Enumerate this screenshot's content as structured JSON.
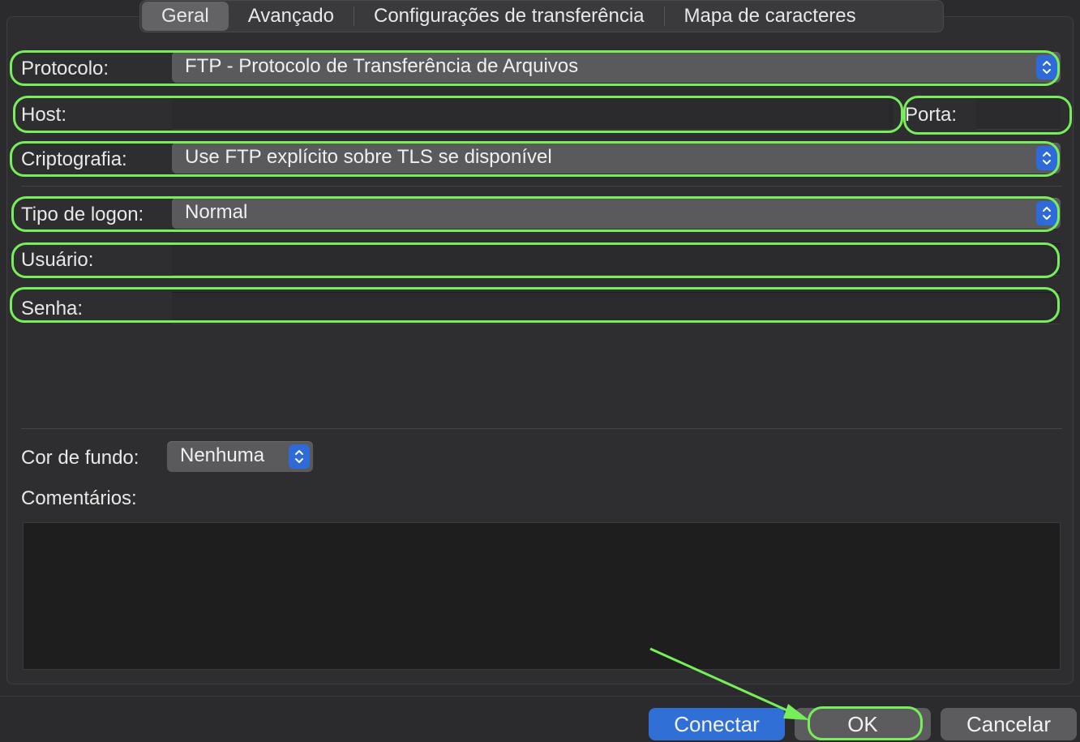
{
  "tabs": [
    {
      "label": "Geral",
      "active": true
    },
    {
      "label": "Avançado",
      "active": false
    },
    {
      "label": "Configurações de transferência",
      "active": false
    },
    {
      "label": "Mapa de caracteres",
      "active": false
    }
  ],
  "form": {
    "protocol_label": "Protocolo:",
    "protocol_value": "FTP - Protocolo de Transferência de Arquivos",
    "host_label": "Host:",
    "host_value": "",
    "port_label": "Porta:",
    "port_value": "",
    "encryption_label": "Criptografia:",
    "encryption_value": "Use FTP explícito sobre TLS se disponível",
    "logon_label": "Tipo de logon:",
    "logon_value": "Normal",
    "user_label": "Usuário:",
    "user_value": "",
    "password_label": "Senha:",
    "password_value": "",
    "bgcolor_label": "Cor de fundo:",
    "bgcolor_value": "Nenhuma",
    "comments_label": "Comentários:",
    "comments_value": ""
  },
  "buttons": {
    "connect": "Conectar",
    "ok": "OK",
    "cancel": "Cancelar"
  },
  "colors": {
    "highlight": "#77ef5a",
    "accent": "#2f6fd6"
  },
  "icons": {
    "stepper": "chevron-up-down-icon"
  }
}
